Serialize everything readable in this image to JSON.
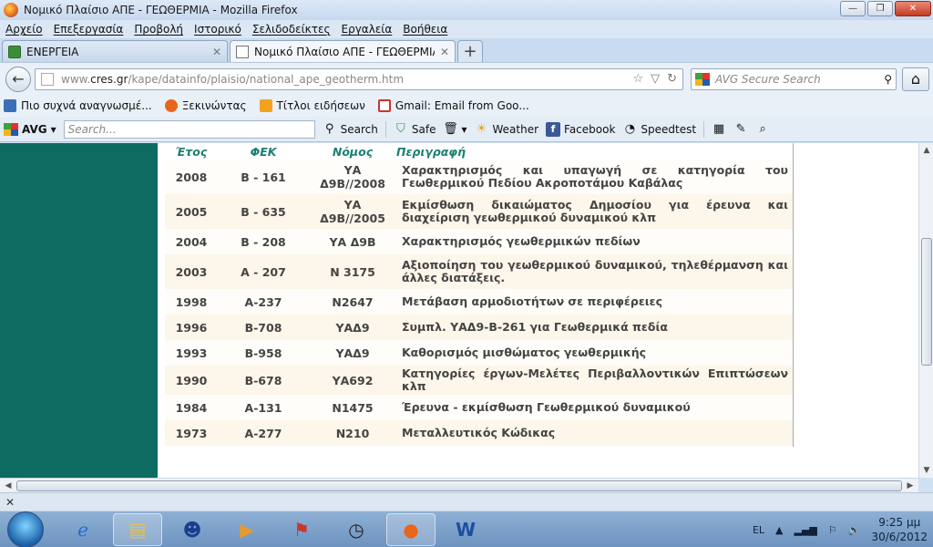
{
  "window": {
    "title": "Νομικό Πλαίσιο ΑΠΕ - ΓΕΩΘΕΡΜΙΑ - Mozilla Firefox",
    "buttons": {
      "min": "—",
      "max": "❐",
      "close": "✕"
    }
  },
  "menu": [
    "Αρχείο",
    "Επεξεργασία",
    "Προβολή",
    "Ιστορικό",
    "Σελιδοδείκτες",
    "Εργαλεία",
    "Βοήθεια"
  ],
  "tabs": [
    {
      "label": "ΕΝΕΡΓΕΙΑ",
      "active": false
    },
    {
      "label": "Νομικό Πλαίσιο ΑΠΕ - ΓΕΩΘΕΡΜΙΑ",
      "active": true
    }
  ],
  "newtab": "+",
  "tab_close": "✕",
  "nav": {
    "back": "←",
    "url_prefix": "www.",
    "url_domain": "cres.gr",
    "url_path": "/kape/datainfo/plaisio/national_ape_geotherm.htm",
    "star": "☆",
    "dropdown": "▽",
    "reload": "↻",
    "search_placeholder": "AVG Secure Search",
    "search_icon": "⚲",
    "home": "⌂"
  },
  "bookmarks": [
    {
      "label": "Πιο συχνά αναγνωσμέ...",
      "icon_color": "#3a6fb5"
    },
    {
      "label": "Ξεκινώντας",
      "icon_color": "#e8661c"
    },
    {
      "label": "Τίτλοι ειδήσεων",
      "icon_color": "#f3a21e"
    },
    {
      "label": "Gmail: Email from Goo...",
      "icon_color": "#c8372d"
    }
  ],
  "avg": {
    "brand": "AVG",
    "dropdown": "▾",
    "search_placeholder": "Search...",
    "search_label": "Search",
    "safe_label": "Safe",
    "weather_label": "Weather",
    "facebook_label": "Facebook",
    "speedtest_label": "Speedtest"
  },
  "table": {
    "headers": [
      "Έτος",
      "ΦΕΚ",
      "Νόμος",
      "Περιγραφή"
    ],
    "rows": [
      {
        "year": "2008",
        "fek": "Β - 161",
        "law": "ΥΑ Δ9Β//2008",
        "desc": "Χαρακτηρισμός και υπαγωγή σε κατηγορία του Γεωθερμικού Πεδίου Ακροποτάμου Καβάλας"
      },
      {
        "year": "2005",
        "fek": "Β - 635",
        "law": "ΥΑ Δ9Β//2005",
        "desc": "Εκμίσθωση δικαιώματος Δημοσίου για έρευνα και διαχείριση γεωθερμικού δυναμικού κλπ"
      },
      {
        "year": "2004",
        "fek": "Β - 208",
        "law": "ΥΑ Δ9Β",
        "desc": "Χαρακτηρισμός γεωθερμικών πεδίων"
      },
      {
        "year": "2003",
        "fek": "Α - 207",
        "law": "Ν 3175",
        "desc": "Αξιοποίηση του γεωθερμικού δυναμικού, τηλεθέρμανση και άλλες διατάξεις."
      },
      {
        "year": "1998",
        "fek": "Α-237",
        "law": "Ν2647",
        "desc": "Μετάβαση αρμοδιοτήτων σε περιφέρειες"
      },
      {
        "year": "1996",
        "fek": "Β-708",
        "law": "ΥΑΔ9",
        "desc": "Συμπλ. ΥΑΔ9-Β-261 για Γεωθερμικά πεδία"
      },
      {
        "year": "1993",
        "fek": "Β-958",
        "law": "ΥΑΔ9",
        "desc": "Καθορισμός μισθώματος γεωθερμικής"
      },
      {
        "year": "1990",
        "fek": "Β-678",
        "law": "ΥΑ692",
        "desc": "Κατηγορίες έργων-Μελέτες Περιβαλλοντικών Επιπτώσεων κλπ"
      },
      {
        "year": "1984",
        "fek": "Α-131",
        "law": "Ν1475",
        "desc": "Έρευνα - εκμίσθωση Γεωθερμικού δυναμικού"
      },
      {
        "year": "1973",
        "fek": "Α-277",
        "law": "Ν210",
        "desc": "Μεταλλευτικός Κώδικας"
      }
    ]
  },
  "addon": {
    "close": "✕"
  },
  "taskbar": {
    "lang": "EL",
    "time": "9:25 μμ",
    "date": "30/6/2012"
  }
}
